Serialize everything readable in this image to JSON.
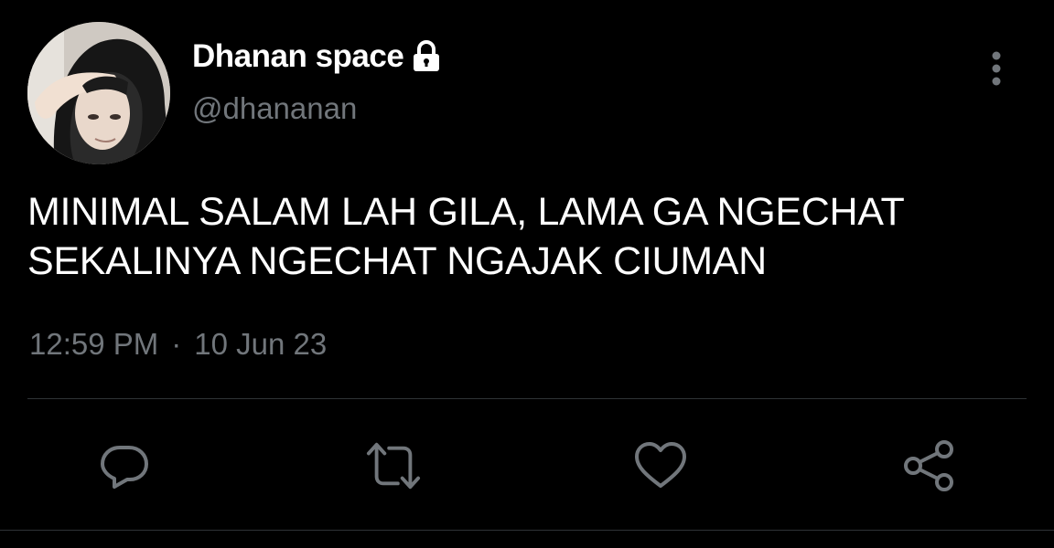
{
  "tweet": {
    "display_name": "Dhanan space",
    "username": "@dhananan",
    "text_lines": [
      "MINIMAL SALAM LAH GILA, LAMA GA NGECHAT",
      "SEKALINYA NGECHAT NGAJAK CIUMAN"
    ],
    "time": "12:59 PM",
    "separator": "·",
    "date": "10 Jun 23"
  },
  "icons": {
    "verified_lock": "lock-icon",
    "more": "more-vertical-icon",
    "actions": [
      "reply-icon",
      "retweet-icon",
      "like-icon",
      "share-icon"
    ]
  },
  "colors": {
    "background": "#000000",
    "text_primary": "#ffffff",
    "text_secondary": "#71767b",
    "divider": "#2f3336"
  }
}
